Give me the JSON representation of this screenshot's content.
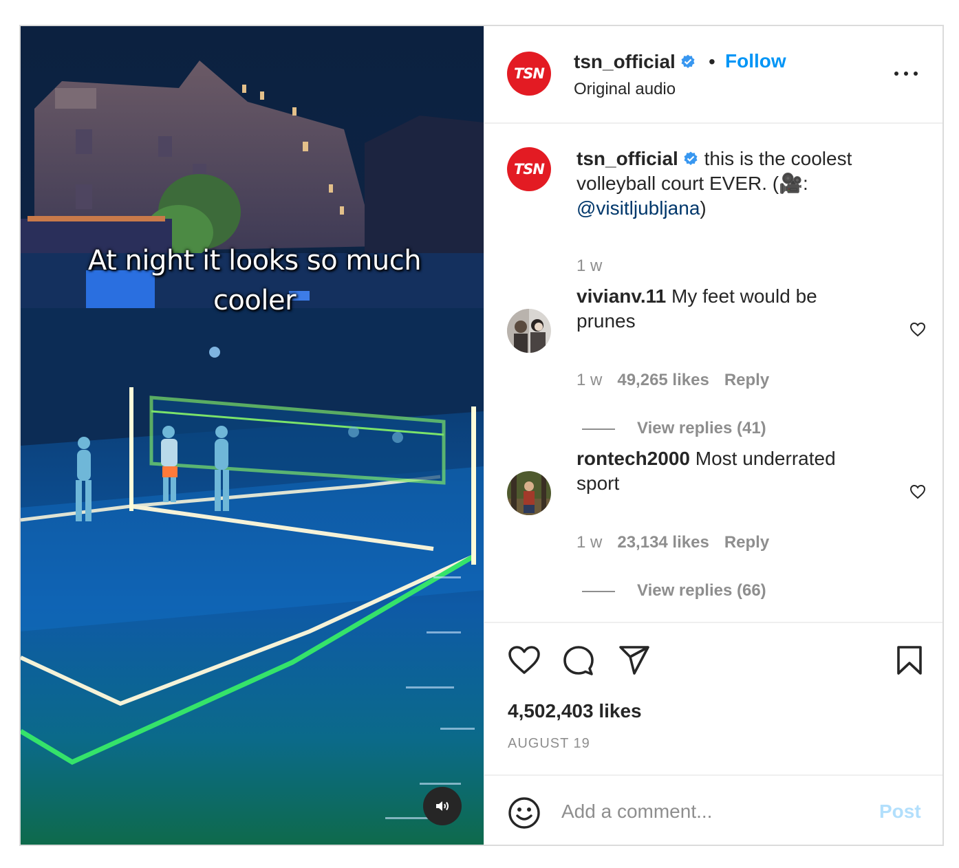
{
  "media": {
    "overlay_caption": "At night it looks so much cooler",
    "mute_icon": "speaker-icon"
  },
  "header": {
    "username": "tsn_official",
    "avatar_text": "TSN",
    "separator": "•",
    "follow_label": "Follow",
    "subtitle": "Original audio",
    "more_icon": "more-options-icon"
  },
  "caption": {
    "username": "tsn_official",
    "avatar_text": "TSN",
    "text": "this is the coolest volleyball court EVER. (🎥:",
    "mention": "@visitljubljana",
    "close": ")",
    "time": "1 w"
  },
  "comments": [
    {
      "username": "vivianv.11",
      "text": "My feet would be prunes",
      "time": "1 w",
      "likes": "49,265 likes",
      "reply_label": "Reply",
      "view_replies": "View replies (41)"
    },
    {
      "username": "rontech2000",
      "text": "Most underrated sport",
      "time": "1 w",
      "likes": "23,134 likes",
      "reply_label": "Reply",
      "view_replies": "View replies (66)"
    }
  ],
  "actions": {
    "like_icon": "heart-icon",
    "comment_icon": "comment-icon",
    "share_icon": "share-icon",
    "save_icon": "bookmark-icon",
    "likes": "4,502,403 likes",
    "date": "AUGUST 19"
  },
  "add_comment": {
    "placeholder": "Add a comment...",
    "post_label": "Post",
    "emoji_icon": "emoji-icon"
  },
  "colors": {
    "accent": "#0095f6",
    "brand": "#e31b23",
    "muted": "#8e8e8e",
    "post_disabled": "#b2dffc"
  }
}
